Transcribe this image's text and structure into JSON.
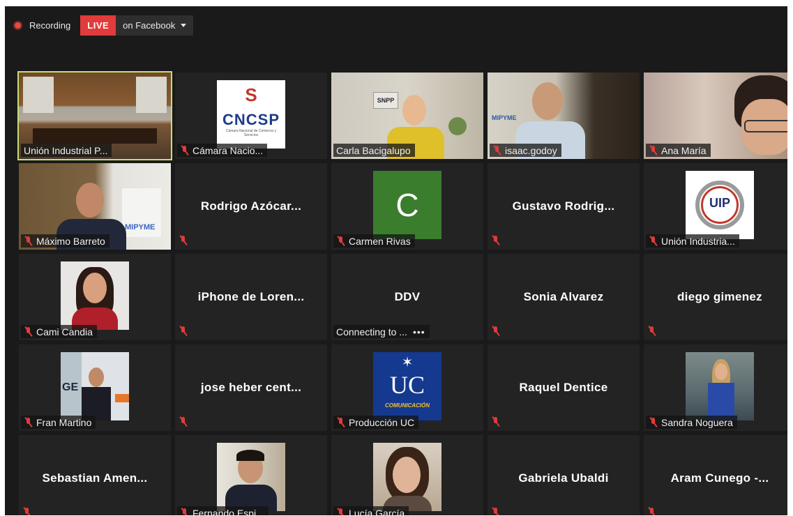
{
  "recording": {
    "label": "Recording"
  },
  "live": {
    "badge": "LIVE",
    "destination": "on Facebook"
  },
  "colors": {
    "active_speaker": "#c8de74",
    "mic_muted": "#e23b3b",
    "live": "#e23b3b"
  },
  "tiles": [
    {
      "name": "Unión Industrial P..."
    },
    {
      "name": "Cámara Nacio...",
      "logo_text": "CNCSP",
      "logo_sub": "Cámara Nacional de Comercio y Servicios"
    },
    {
      "name": "Carla Bacigalupo",
      "banner": "SNPP"
    },
    {
      "name": "isaac.godoy",
      "banner": "MIPYME"
    },
    {
      "name": "Ana María"
    },
    {
      "name": "Máximo Barreto",
      "banner": "MIPYME"
    },
    {
      "name": "Rodrigo  Azócar..."
    },
    {
      "name": "Carmen Rivas",
      "initial": "C"
    },
    {
      "name": "Gustavo  Rodrig..."
    },
    {
      "name": "Unión Industria...",
      "logo_text": "UIP"
    },
    {
      "name": "Cami Candia"
    },
    {
      "name": "iPhone  de  Loren..."
    },
    {
      "name": "DDV",
      "status": "Connecting to ..."
    },
    {
      "name": "Sonia Alvarez"
    },
    {
      "name": "diego gimenez"
    },
    {
      "name": "Fran Martino",
      "banner": "GE"
    },
    {
      "name": "jose  heber  cent..."
    },
    {
      "name": "Producción UC",
      "logo_text": "UC",
      "logo_sub": "COMUNICACIÓN"
    },
    {
      "name": "Raquel Dentice"
    },
    {
      "name": "Sandra Noguera"
    },
    {
      "name": "Sebastian  Amen..."
    },
    {
      "name": "Fernando Espi..."
    },
    {
      "name": "Lucía García"
    },
    {
      "name": "Gabriela Ubaldi"
    },
    {
      "name": "Aram  Cunego  -..."
    }
  ]
}
